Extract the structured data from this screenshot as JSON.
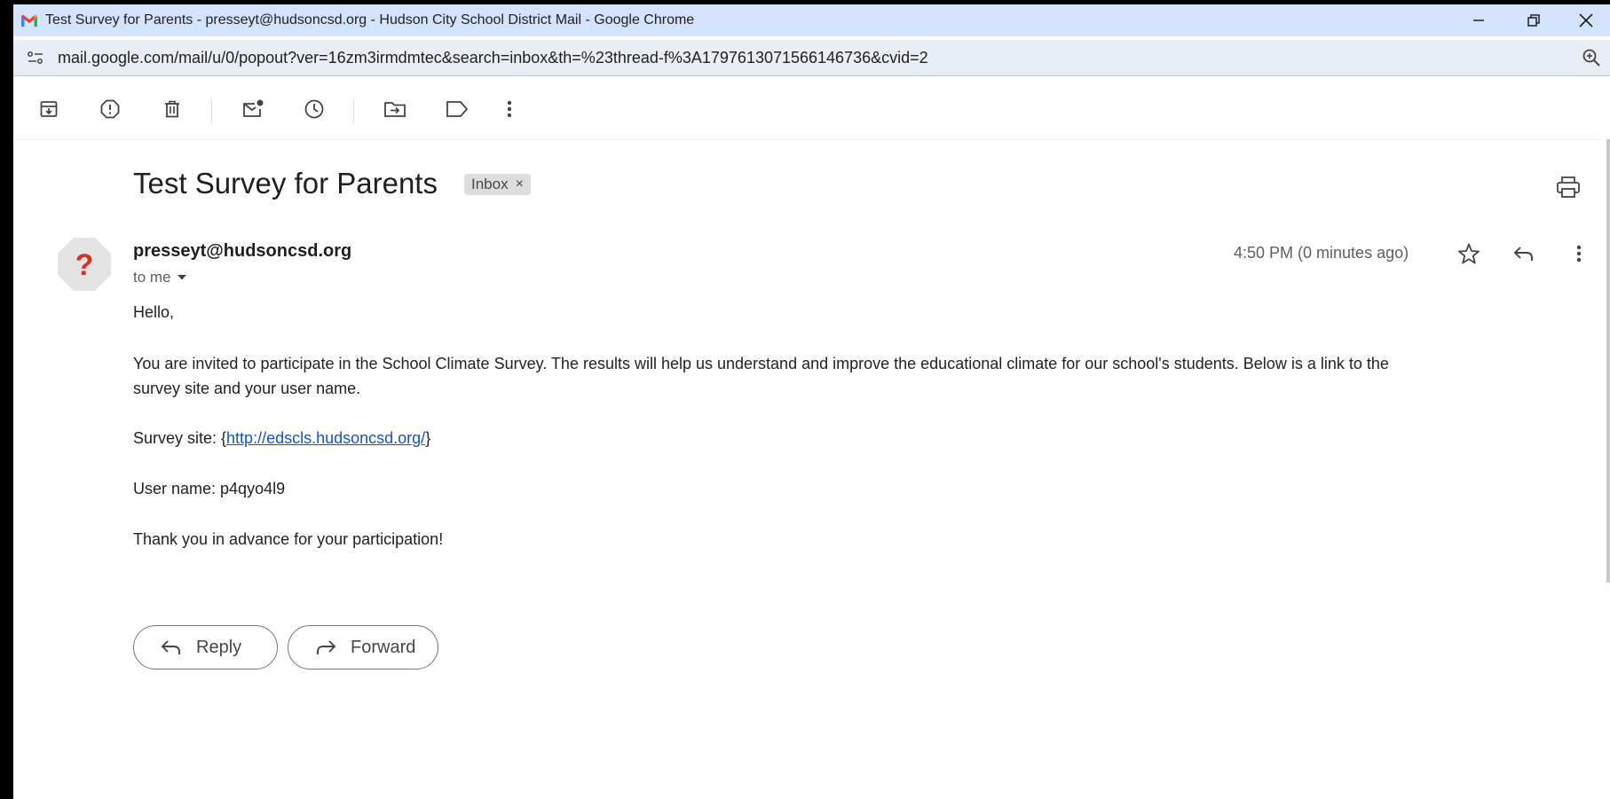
{
  "browser": {
    "tab_title": "Test Survey for Parents - presseyt@hudsoncsd.org - Hudson City School District Mail - Google Chrome",
    "url": "mail.google.com/mail/u/0/popout?ver=16zm3irmdmtec&search=inbox&th=%23thread-f%3A1797613071566146736&cvid=2"
  },
  "toolbar": {
    "icons": [
      "archive-icon",
      "report-spam-icon",
      "delete-icon",
      "mark-unread-icon",
      "snooze-icon",
      "move-to-icon",
      "label-icon",
      "more-vert-icon"
    ]
  },
  "email": {
    "subject": "Test Survey for Parents",
    "label": "Inbox",
    "label_remove": "×",
    "sender": "presseyt@hudsoncsd.org",
    "recipient_line": "to me",
    "timestamp": "4:50 PM (0 minutes ago)",
    "avatar_glyph": "?",
    "body": {
      "greeting": "Hello,",
      "paragraph1_line1": "You are invited to participate in the School Climate Survey. The results will help us understand and improve the educational climate for our school's students. Below is a link to the",
      "paragraph1_line2": "survey site and your user name.",
      "survey_prefix": "Survey site: {",
      "survey_link": "http://edscls.hudsoncsd.org/",
      "survey_suffix": "}",
      "username_line": "User name: p4qyo4l9",
      "closing": "Thank you in advance for your participation!"
    }
  },
  "actions": {
    "reply_label": "Reply",
    "forward_label": "Forward"
  },
  "colors": {
    "titlebar": "#d3e3fd",
    "urlbar": "#e9eef6",
    "link": "#1155cc",
    "avatar_glyph": "#d93025"
  }
}
